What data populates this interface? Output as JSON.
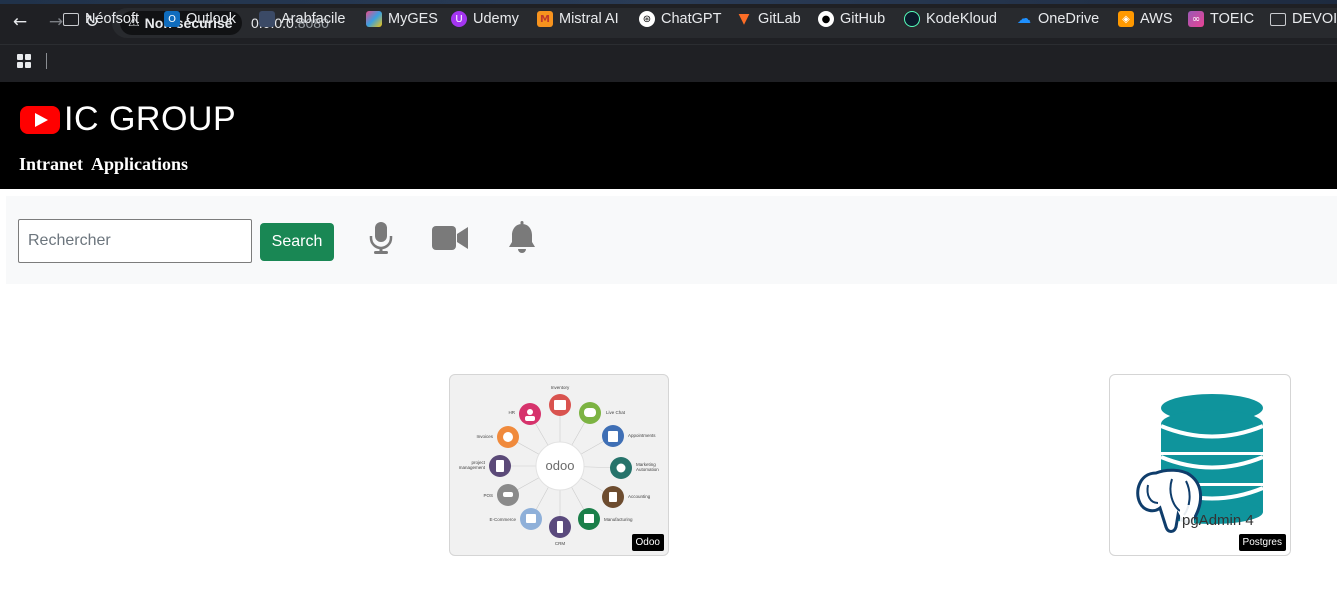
{
  "browser": {
    "security_label": "Non sécurisé",
    "url_host": "0.0.0.0",
    "url_port": ":8080",
    "bookmarks": [
      {
        "label": "Néofsoft",
        "icon": "folder-icon",
        "color": ""
      },
      {
        "label": "Outlook",
        "icon": "outlook-icon",
        "color": "#0f6cbd"
      },
      {
        "label": "Arabfacile",
        "icon": "arabfacile-icon",
        "color": "#3b4a66"
      },
      {
        "label": "MyGES",
        "icon": "myges-icon",
        "color": "#e94b8b"
      },
      {
        "label": "Udemy",
        "icon": "udemy-icon",
        "color": "#a435f0"
      },
      {
        "label": "Mistral AI",
        "icon": "mistral-icon",
        "color": "#f7931e"
      },
      {
        "label": "ChatGPT",
        "icon": "chatgpt-icon",
        "color": "#ffffff"
      },
      {
        "label": "GitLab",
        "icon": "gitlab-icon",
        "color": "#fc6d26"
      },
      {
        "label": "GitHub",
        "icon": "github-icon",
        "color": "#ffffff"
      },
      {
        "label": "KodeKloud",
        "icon": "kodekloud-icon",
        "color": "#0b1b2b"
      },
      {
        "label": "OneDrive",
        "icon": "onedrive-icon",
        "color": "#1e90ff"
      },
      {
        "label": "AWS",
        "icon": "aws-icon",
        "color": "#ff9900"
      },
      {
        "label": "TOEIC",
        "icon": "toeic-icon",
        "color": "#9b59b6"
      },
      {
        "label": "DEVOI",
        "icon": "folder-icon",
        "color": ""
      }
    ]
  },
  "header": {
    "brand": "IC GROUP",
    "subtitle": "Intranet  Applications",
    "logo_color": "#ff0000"
  },
  "toolbar": {
    "search_placeholder": "Rechercher",
    "search_label": "Search",
    "search_color": "#198754",
    "icons": [
      "microphone-icon",
      "video-camera-icon",
      "bell-icon"
    ]
  },
  "apps": [
    {
      "name": "Odoo",
      "tag": "Odoo",
      "center_text": "odoo",
      "modules": [
        "Inventory",
        "Live Chat",
        "Appointments",
        "Marketing Automation",
        "Accounting",
        "Manufacturing",
        "CRM",
        "E-Commerce",
        "POS",
        "project management",
        "Invoices",
        "HR"
      ]
    },
    {
      "name": "pgAdmin",
      "tag": "Postgres",
      "logo_text": "pgAdmin 4",
      "db_color": "#0f949c"
    }
  ]
}
